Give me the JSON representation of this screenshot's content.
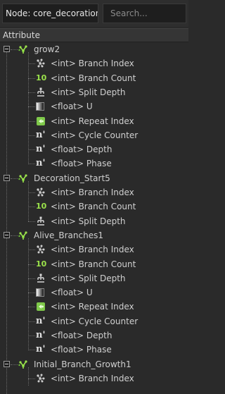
{
  "toolbar": {
    "node_label": "Node: core_decoration",
    "search_placeholder": "Search..."
  },
  "header": {
    "title": "Attribute"
  },
  "tree": [
    {
      "name": "grow2",
      "attributes": [
        {
          "icon": "branch-index-icon",
          "label": "<int> Branch Index"
        },
        {
          "icon": "branch-count-icon",
          "label": "<int> Branch Count"
        },
        {
          "icon": "split-depth-icon",
          "label": "<int> Split Depth"
        },
        {
          "icon": "gradient-icon",
          "label": "<float> U"
        },
        {
          "icon": "repeat-index-icon",
          "label": "<int> Repeat Index"
        },
        {
          "icon": "cycle-icon",
          "label": "<int> Cycle Counter"
        },
        {
          "icon": "depth-icon",
          "label": "<float> Depth"
        },
        {
          "icon": "phase-icon",
          "label": "<float> Phase"
        }
      ]
    },
    {
      "name": "Decoration_Start5",
      "attributes": [
        {
          "icon": "branch-index-icon",
          "label": "<int> Branch Index"
        },
        {
          "icon": "branch-count-icon",
          "label": "<int> Branch Count"
        },
        {
          "icon": "split-depth-icon",
          "label": "<int> Split Depth"
        }
      ]
    },
    {
      "name": "Alive_Branches1",
      "attributes": [
        {
          "icon": "branch-index-icon",
          "label": "<int> Branch Index"
        },
        {
          "icon": "branch-count-icon",
          "label": "<int> Branch Count"
        },
        {
          "icon": "split-depth-icon",
          "label": "<int> Split Depth"
        },
        {
          "icon": "gradient-icon",
          "label": "<float> U"
        },
        {
          "icon": "repeat-index-icon",
          "label": "<int> Repeat Index"
        },
        {
          "icon": "cycle-icon",
          "label": "<int> Cycle Counter"
        },
        {
          "icon": "depth-icon",
          "label": "<float> Depth"
        },
        {
          "icon": "phase-icon",
          "label": "<float> Phase"
        }
      ]
    },
    {
      "name": "Initial_Branch_Growth1",
      "attributes": [
        {
          "icon": "branch-index-icon",
          "label": "<int> Branch Index"
        }
      ]
    }
  ],
  "icon_glyphs": {
    "branch-count-icon": "10",
    "cycle-icon": "n'",
    "depth-icon": "n'",
    "phase-icon": "n'"
  },
  "colors": {
    "accent_green": "#9be34b",
    "background": "#2a2a2a",
    "text": "#d0d0d0"
  }
}
